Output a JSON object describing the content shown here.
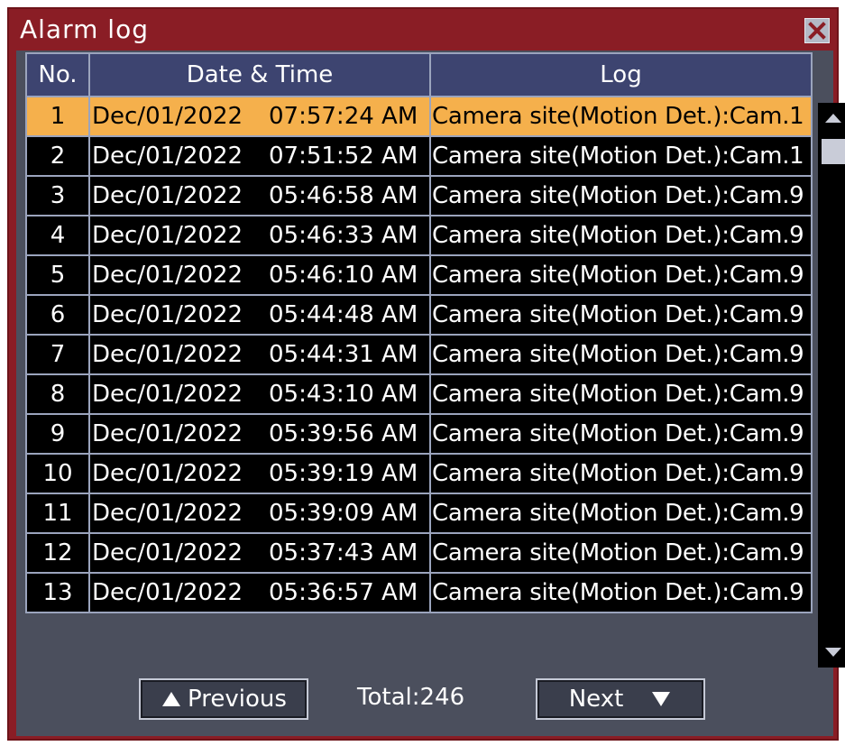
{
  "window": {
    "title": "Alarm log"
  },
  "table": {
    "headers": {
      "no": "No.",
      "datetime": "Date & Time",
      "log": "Log"
    },
    "rows": [
      {
        "no": "1",
        "date": "Dec/01/2022",
        "time": "07:57:24 AM",
        "log": "Camera site(Motion Det.):Cam.1"
      },
      {
        "no": "2",
        "date": "Dec/01/2022",
        "time": "07:51:52 AM",
        "log": "Camera site(Motion Det.):Cam.1"
      },
      {
        "no": "3",
        "date": "Dec/01/2022",
        "time": "05:46:58 AM",
        "log": "Camera site(Motion Det.):Cam.9"
      },
      {
        "no": "4",
        "date": "Dec/01/2022",
        "time": "05:46:33 AM",
        "log": "Camera site(Motion Det.):Cam.9"
      },
      {
        "no": "5",
        "date": "Dec/01/2022",
        "time": "05:46:10 AM",
        "log": "Camera site(Motion Det.):Cam.9"
      },
      {
        "no": "6",
        "date": "Dec/01/2022",
        "time": "05:44:48 AM",
        "log": "Camera site(Motion Det.):Cam.9"
      },
      {
        "no": "7",
        "date": "Dec/01/2022",
        "time": "05:44:31 AM",
        "log": "Camera site(Motion Det.):Cam.9"
      },
      {
        "no": "8",
        "date": "Dec/01/2022",
        "time": "05:43:10 AM",
        "log": "Camera site(Motion Det.):Cam.9"
      },
      {
        "no": "9",
        "date": "Dec/01/2022",
        "time": "05:39:56 AM",
        "log": "Camera site(Motion Det.):Cam.9"
      },
      {
        "no": "10",
        "date": "Dec/01/2022",
        "time": "05:39:19 AM",
        "log": "Camera site(Motion Det.):Cam.9"
      },
      {
        "no": "11",
        "date": "Dec/01/2022",
        "time": "05:39:09 AM",
        "log": "Camera site(Motion Det.):Cam.9"
      },
      {
        "no": "12",
        "date": "Dec/01/2022",
        "time": "05:37:43 AM",
        "log": "Camera site(Motion Det.):Cam.9"
      },
      {
        "no": "13",
        "date": "Dec/01/2022",
        "time": "05:36:57 AM",
        "log": "Camera site(Motion Det.):Cam.9"
      }
    ],
    "selected_row": "1"
  },
  "footer": {
    "previous_label": "Previous",
    "next_label": "Next",
    "total_text": "Total:246"
  },
  "icons": {
    "close": "close-icon",
    "previous": "triangle-up-icon",
    "next": "triangle-down-icon",
    "scroll_up": "scroll-up-icon",
    "scroll_down": "scroll-down-icon"
  },
  "colors": {
    "window_frame": "#8a1d25",
    "header_bg": "#3d4470",
    "selected_row": "#f5b04c",
    "row_bg": "#000000",
    "panel_bg": "#4b4f5d"
  }
}
